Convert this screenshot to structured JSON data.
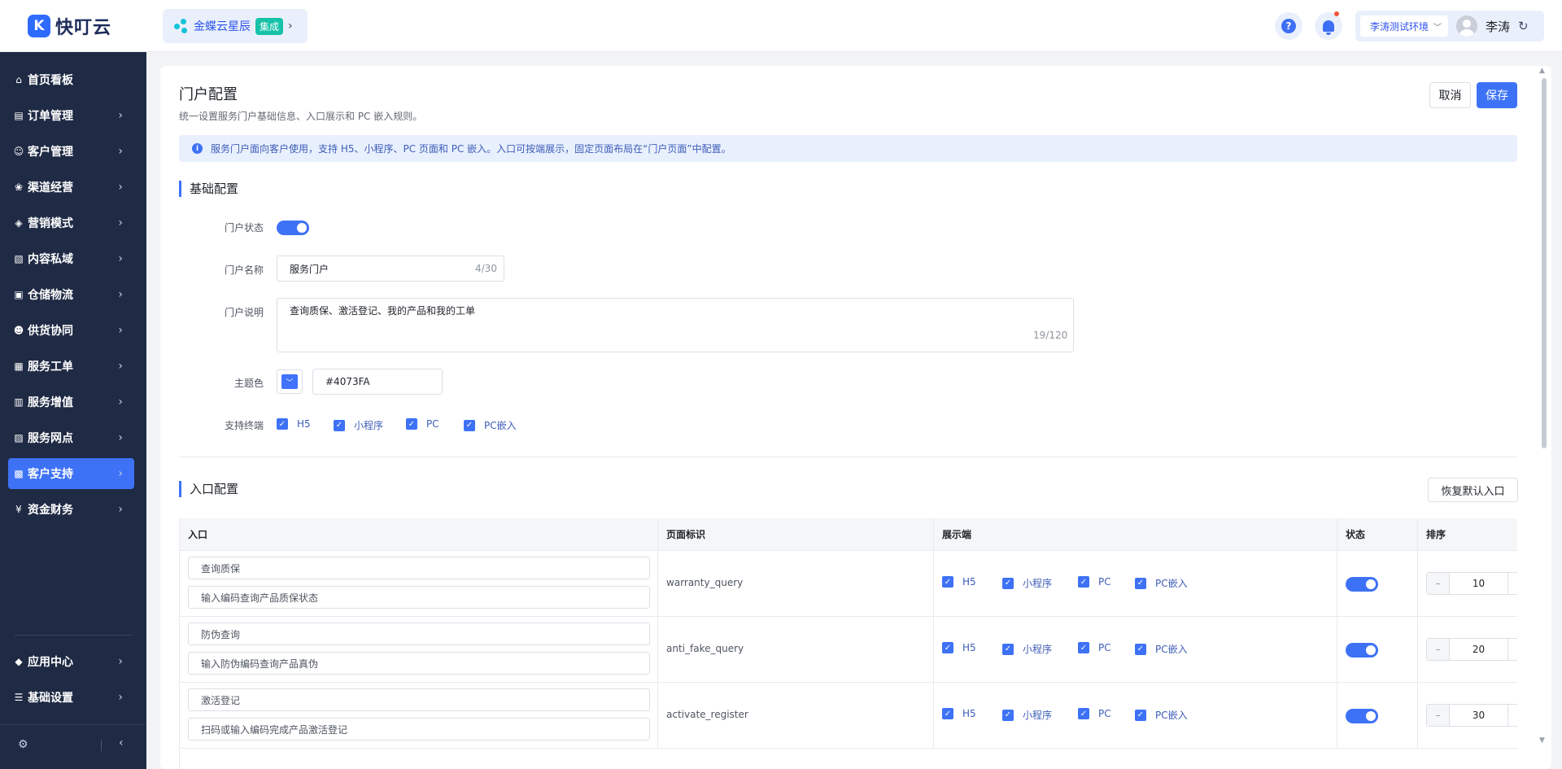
{
  "app": {
    "logo_mark": "K",
    "name": "快叮云"
  },
  "integration": {
    "name": "金蝶云星辰",
    "badge": "集成"
  },
  "header": {
    "help_symbol": "?",
    "environment": "李涛测试环境",
    "user_name": "李涛"
  },
  "sidebar": {
    "items": [
      {
        "label": "首页看板",
        "icon": "home-icon"
      },
      {
        "label": "订单管理",
        "icon": "order-icon"
      },
      {
        "label": "客户管理",
        "icon": "user-icon"
      },
      {
        "label": "渠道经营",
        "icon": "channel-icon"
      },
      {
        "label": "营销模式",
        "icon": "tag-icon"
      },
      {
        "label": "内容私域",
        "icon": "image-icon"
      },
      {
        "label": "仓储物流",
        "icon": "warehouse-icon"
      },
      {
        "label": "供货协同",
        "icon": "supplier-icon"
      },
      {
        "label": "服务工单",
        "icon": "ticket-icon"
      },
      {
        "label": "服务增值",
        "icon": "gift-icon"
      },
      {
        "label": "服务网点",
        "icon": "store-icon"
      },
      {
        "label": "客户支持",
        "icon": "support-icon",
        "active": true
      },
      {
        "label": "资金财务",
        "icon": "finance-icon"
      }
    ],
    "bottom_items": [
      {
        "label": "应用中心",
        "icon": "app-center-icon"
      },
      {
        "label": "基础设置",
        "icon": "settings-icon"
      }
    ]
  },
  "page": {
    "title": "门户配置",
    "subtitle": "统一设置服务门户基础信息、入口展示和 PC 嵌入规则。",
    "cancel_label": "取消",
    "save_label": "保存",
    "info": "服务门户面向客户使用，支持 H5、小程序、PC 页面和 PC 嵌入。入口可按端展示，固定页面布局在“门户页面”中配置。"
  },
  "basic": {
    "section_title": "基础配置",
    "status_label": "门户状态",
    "status_on": true,
    "name_label": "门户名称",
    "name_value": "服务门户",
    "name_count": "4/30",
    "desc_label": "门户说明",
    "desc_value": "查询质保、激活登记、我的产品和我的工单",
    "desc_count": "19/120",
    "theme_label": "主题色",
    "theme_color": "#4073FA",
    "terminal_label": "支持终端",
    "terminals": [
      "H5",
      "小程序",
      "PC",
      "PC嵌入"
    ]
  },
  "entry": {
    "section_title": "入口配置",
    "reset_label": "恢复默认入口",
    "columns": [
      "入口",
      "页面标识",
      "展示端",
      "状态",
      "排序"
    ],
    "rows": [
      {
        "name": "查询质保",
        "desc": "输入编码查询产品质保状态",
        "key": "warranty_query",
        "terminals": [
          "H5",
          "小程序",
          "PC",
          "PC嵌入"
        ],
        "enabled": true,
        "sort": "10"
      },
      {
        "name": "防伪查询",
        "desc": "输入防伪编码查询产品真伪",
        "key": "anti_fake_query",
        "terminals": [
          "H5",
          "小程序",
          "PC",
          "PC嵌入"
        ],
        "enabled": true,
        "sort": "20"
      },
      {
        "name": "激活登记",
        "desc": "扫码或输入编码完成产品激活登记",
        "key": "activate_register",
        "terminals": [
          "H5",
          "小程序",
          "PC",
          "PC嵌入"
        ],
        "enabled": true,
        "sort": "30"
      }
    ]
  },
  "colors": {
    "primary": "#3e72f6",
    "sidebar_bg": "#1f2a44"
  }
}
